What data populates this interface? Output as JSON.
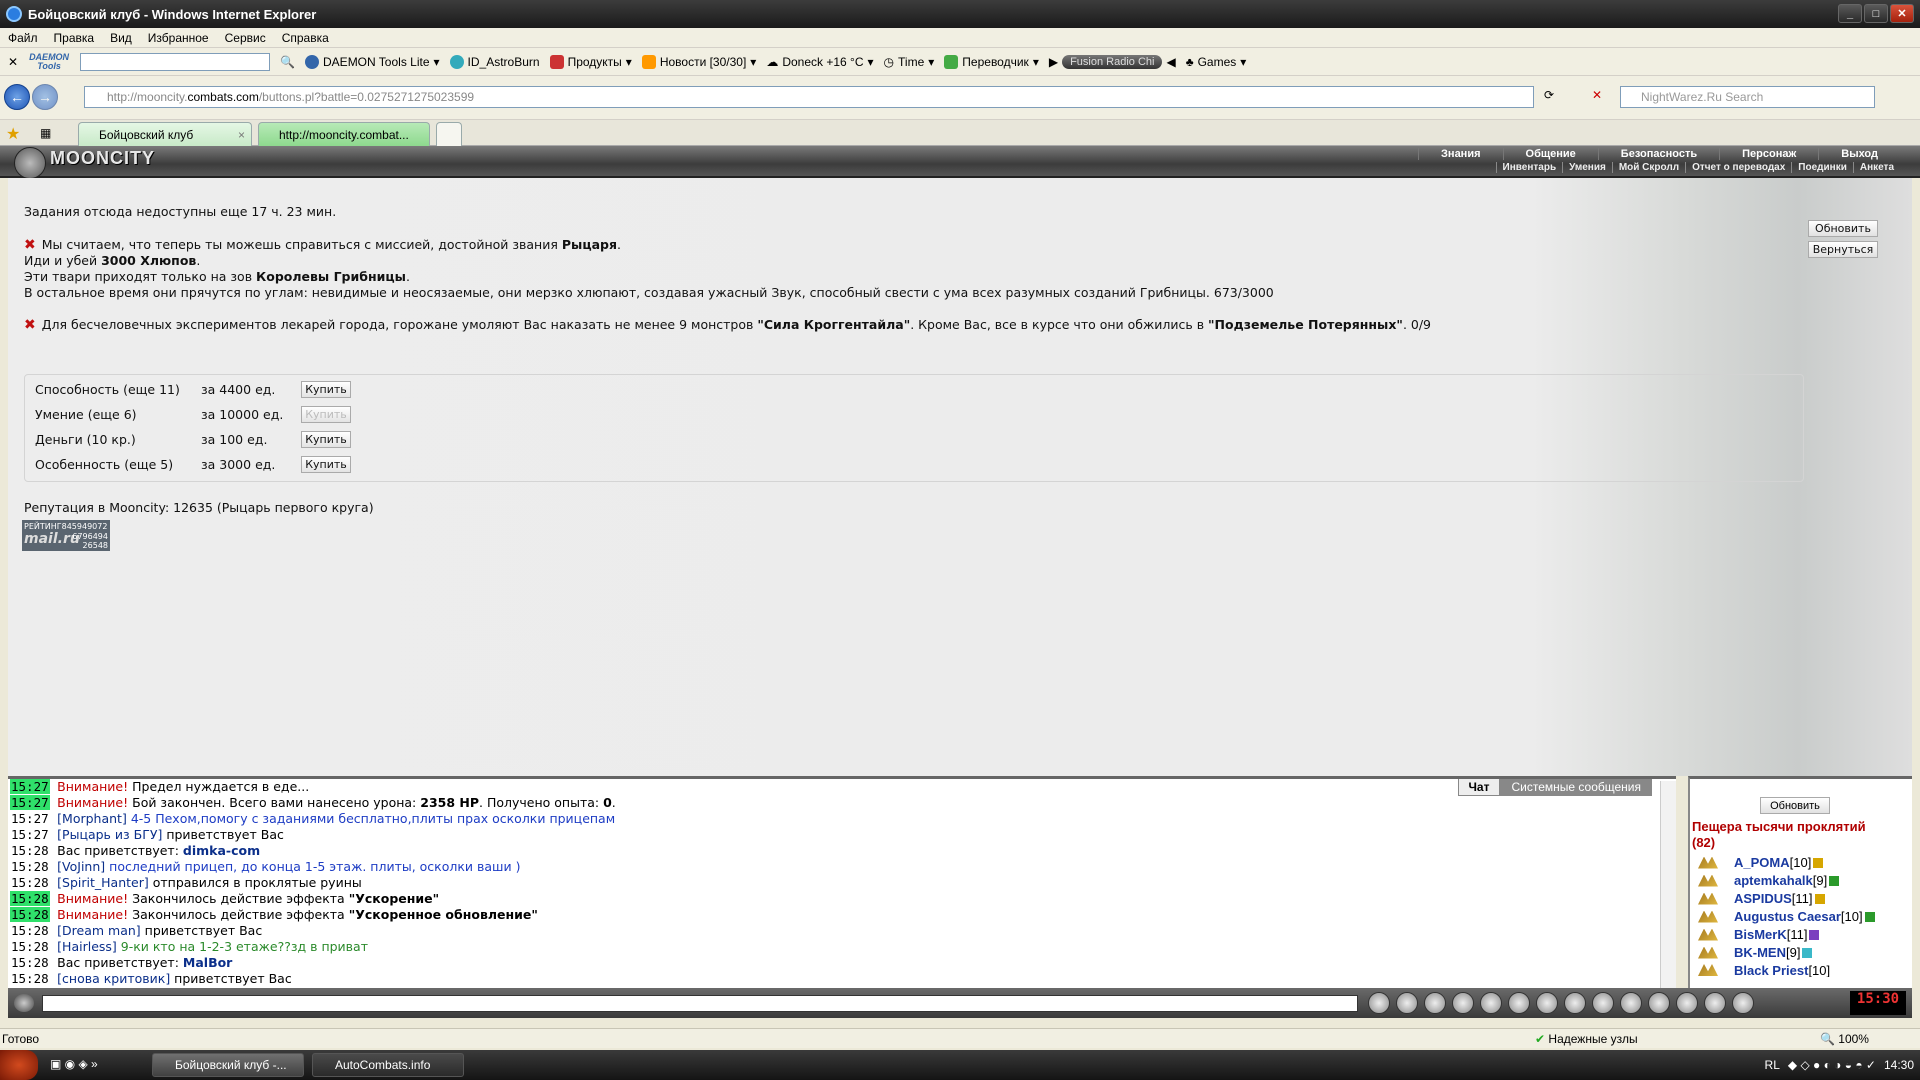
{
  "window": {
    "title": "Бойцовский клуб - Windows Internet Explorer"
  },
  "menu": [
    "Файл",
    "Правка",
    "Вид",
    "Избранное",
    "Сервис",
    "Справка"
  ],
  "toolbar": {
    "daemon_logo": "DAEMON Tools",
    "daemon_lite": "DAEMON Tools Lite",
    "astroburn": "ID_AstroBurn",
    "products": "Продукты",
    "news": "Новости [30/30]",
    "weather": "Doneck +16 °C",
    "time": "Time",
    "translator": "Переводчик",
    "radio": "Fusion Radio Chi",
    "games": "Games"
  },
  "address": {
    "url_prefix": "http://mooncity.",
    "url_domain": "combats.com",
    "url_rest": "/buttons.pl?battle=0.0275271275023599",
    "search_placeholder": "NightWarez.Ru Search"
  },
  "tabs": [
    "Бойцовский клуб",
    "http://mooncity.combat..."
  ],
  "game": {
    "logo": "MOONCITY",
    "nav": [
      "Знания",
      "Общение",
      "Безопасность",
      "Персонаж",
      "Выход"
    ],
    "subnav": [
      "Инвентарь",
      "Умения",
      "Мой Скролл",
      "Отчет о переводах",
      "Поединки",
      "Анкета"
    ],
    "buttons": {
      "refresh": "Обновить",
      "back": "Вернуться"
    },
    "quests_unavailable": "Задания отсюда недоступны еще 17 ч. 23 мин.",
    "quest1": {
      "line1_a": "Мы считаем, что теперь ты можешь справиться с миссией, достойной звания ",
      "line1_b": "Рыцаря",
      "line1_c": ".",
      "line2_a": "Иди и убей ",
      "line2_b": "3000 Хлюпов",
      "line2_c": ".",
      "line3_a": "Эти твари приходят только на зов ",
      "line3_b": "Королевы Грибницы",
      "line3_c": ".",
      "line4": "В остальное время они прячутся по углам: невидимые и неосязаемые, они мерзко хлюпают, создавая ужасный Звук, способный свести с ума всех разумных созданий Грибницы. 673/3000"
    },
    "quest2": {
      "a": "Для бесчеловечных экспериментов лекарей города, горожане умоляют Вас наказать не менее 9 монстров ",
      "b": "\"Сила Кроггентайла\"",
      "c": ". Кроме Вас, все в курсе что они обжились в ",
      "d": "\"Подземелье Потерянных\"",
      "e": ". 0/9"
    },
    "shop": [
      {
        "name": "Способность (еще 11)",
        "price": "за 4400 ед.",
        "btn": "Купить"
      },
      {
        "name": "Умение (еще 6)",
        "price": "за 10000 ед.",
        "btn": "Купить"
      },
      {
        "name": "Деньги (10 кр.)",
        "price": "за 100 ед.",
        "btn": "Купить"
      },
      {
        "name": "Особенность (еще 5)",
        "price": "за 3000 ед.",
        "btn": "Купить"
      }
    ],
    "reputation": "Репутация в Mooncity: 12635 (Рыцарь первого круга)",
    "counter": {
      "top": "РЕЙТИНГ845949072",
      "logo": "mail.ru",
      "n1": "6796494",
      "n2": "26548"
    }
  },
  "chat": {
    "tabs": [
      "Чат",
      "Системные сообщения"
    ],
    "l1": {
      "t": "15:27",
      "w": "Внимание!",
      "x": " Предел нуждается в еде..."
    },
    "l2": {
      "t": "15:27",
      "w": "Внимание!",
      "x": " Бой закончен. Всего вами нанесено урона: ",
      "b1": "2358 HP",
      "x2": ". Получено опыта: ",
      "b2": "0",
      "x3": "."
    },
    "l3": {
      "t": "15:27",
      "n": "[Morphant]",
      "x": " 4-5 Пехом,помогу с заданиями бесплатно,плиты прах осколки прицепам"
    },
    "l4": {
      "t": "15:27",
      "n": "[Рыцарь из БГУ]",
      "x": " приветствует Вас"
    },
    "l5": {
      "t": "15:28",
      "x": "Вас приветствует: ",
      "n": "dimka-com"
    },
    "l6": {
      "t": "15:28",
      "n": "[VoJinn]",
      "x": " последний прицеп, до конца 1-5 этаж. плиты, осколки ваши )"
    },
    "l7": {
      "t": "15:28",
      "n": "[Spirit_Hanter]",
      "x": " отправился в проклятые руины"
    },
    "l8": {
      "t": "15:28",
      "w": "Внимание!",
      "x": " Закончилось действие эффекта ",
      "b": "\"Ускорение\""
    },
    "l9": {
      "t": "15:28",
      "w": "Внимание!",
      "x": " Закончилось действие эффекта ",
      "b": "\"Ускоренное обновление\""
    },
    "l10": {
      "t": "15:28",
      "n": "[Dream man]",
      "x": " приветствует Вас"
    },
    "l11": {
      "t": "15:28",
      "n": "[Hairless]",
      "x": " 9-ки кто на 1-2-3 етаже??зд в приват"
    },
    "l12": {
      "t": "15:28",
      "x": "Вас приветствует: ",
      "n": "MalBor"
    },
    "l13": {
      "t": "15:28",
      "n": "[снова критовик]",
      "x": " приветствует Вас"
    }
  },
  "userlist": {
    "refresh": "Обновить",
    "location": "Пещера тысячи проклятий (82)",
    "users": [
      {
        "name": "A_POMA",
        "level": "[10]"
      },
      {
        "name": "aptemkahalk",
        "level": "[9]"
      },
      {
        "name": "ASPIDUS",
        "level": "[11]"
      },
      {
        "name": "Augustus Caesar",
        "level": "[10]"
      },
      {
        "name": "BisMerK",
        "level": "[11]"
      },
      {
        "name": "BK-MEN",
        "level": "[9]"
      },
      {
        "name": "Black Priest",
        "level": "[10]"
      }
    ]
  },
  "clock": "15:30",
  "status": {
    "left": "Готово",
    "zone": "Надежные узлы",
    "zoom": "100%"
  },
  "taskbar": {
    "tasks": [
      "Бойцовский клуб -...",
      "AutoCombats.info"
    ],
    "lang": "RL",
    "time": "14:30"
  }
}
